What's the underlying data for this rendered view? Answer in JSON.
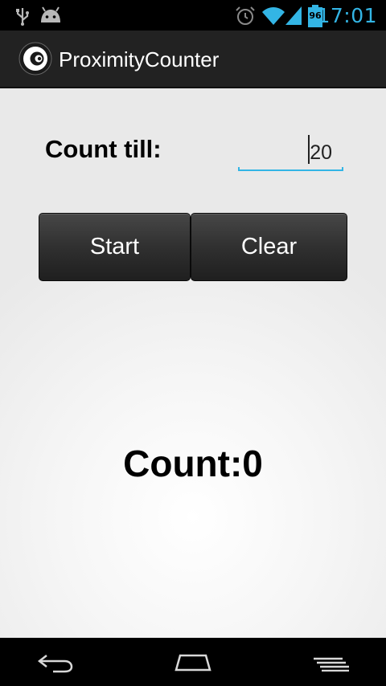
{
  "status_bar": {
    "time": "17:01",
    "battery_level": "96",
    "icons": [
      "usb-icon",
      "android-debug-icon",
      "alarm-icon",
      "wifi-icon",
      "signal-icon",
      "battery-icon"
    ],
    "accent_color": "#33b5e5"
  },
  "action_bar": {
    "title": "ProximityCounter",
    "icon": "app-logo-icon"
  },
  "form": {
    "label": "Count till:",
    "input_value": "20"
  },
  "buttons": {
    "start_label": "Start",
    "clear_label": "Clear"
  },
  "counter": {
    "text": "Count:0"
  },
  "nav_bar": {
    "icons": [
      "back-icon",
      "home-icon",
      "recent-apps-icon"
    ]
  }
}
